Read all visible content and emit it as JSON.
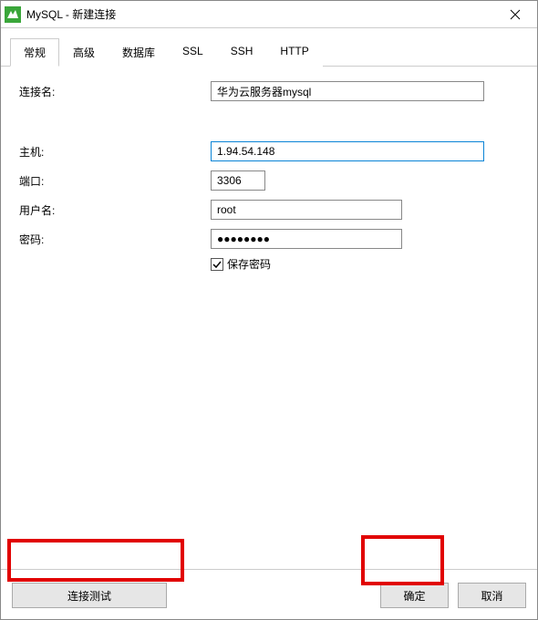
{
  "titlebar": {
    "title": "MySQL - 新建连接"
  },
  "tabs": {
    "general": "常规",
    "advanced": "高级",
    "database": "数据库",
    "ssl": "SSL",
    "ssh": "SSH",
    "http": "HTTP"
  },
  "form": {
    "connection_name_label": "连接名:",
    "connection_name_value": "华为云服务器mysql",
    "host_label": "主机:",
    "host_value": "1.94.54.148",
    "port_label": "端口:",
    "port_value": "3306",
    "user_label": "用户名:",
    "user_value": "root",
    "password_label": "密码:",
    "password_value": "●●●●●●●●",
    "save_password_label": "保存密码",
    "save_password_checked": true
  },
  "buttons": {
    "test_connection": "连接测试",
    "ok": "确定",
    "cancel": "取消"
  },
  "colors": {
    "highlight": "#e10000",
    "focus_border": "#0a84d6",
    "icon_green": "#3aa63a"
  }
}
